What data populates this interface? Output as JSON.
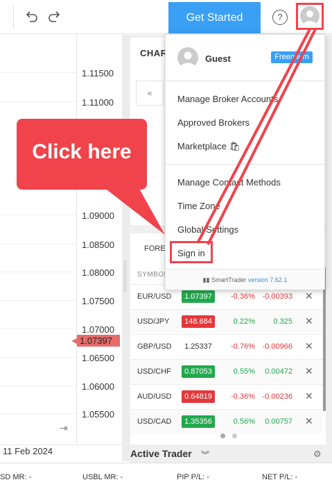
{
  "toolbar": {
    "undo_icon": "undo-icon",
    "redo_icon": "redo-icon",
    "get_started_label": "Get Started",
    "help_label": "?",
    "avatar_icon": "user-avatar-icon"
  },
  "chart": {
    "price_labels": [
      "1.11500",
      "1.11000",
      "1.09000",
      "1.08500",
      "1.08000",
      "1.07500",
      "1.07000",
      "1.06500",
      "1.06000",
      "1.05500"
    ],
    "current_price": "1.07397",
    "date_label": "11 Feb 2024",
    "jump_icon": "jump-to-end-icon",
    "marker_color": "#e86a6a"
  },
  "chart_panel": {
    "title": "CHAR",
    "toggle_label": "«"
  },
  "forex": {
    "tab_label": "FOREX",
    "symbol_header": "SYMBOL",
    "rows": [
      {
        "symbol": "EUR/USD",
        "price": "1.07397",
        "dir": "up",
        "pct": "-0.36%",
        "pct_dir": "neg",
        "change": "-0.00393",
        "change_dir": "neg"
      },
      {
        "symbol": "USD/JPY",
        "price": "148.684",
        "dir": "down",
        "pct": "0.22%",
        "pct_dir": "pos",
        "change": "0.325",
        "change_dir": "pos"
      },
      {
        "symbol": "GBP/USD",
        "price": "1.25337",
        "dir": "flat",
        "pct": "-0.76%",
        "pct_dir": "neg",
        "change": "-0.00966",
        "change_dir": "neg"
      },
      {
        "symbol": "USD/CHF",
        "price": "0.87053",
        "dir": "up",
        "pct": "0.55%",
        "pct_dir": "pos",
        "change": "0.00472",
        "change_dir": "pos"
      },
      {
        "symbol": "AUD/USD",
        "price": "0.64819",
        "dir": "down",
        "pct": "-0.36%",
        "pct_dir": "neg",
        "change": "-0.00236",
        "change_dir": "neg"
      },
      {
        "symbol": "USD/CAD",
        "price": "1.35356",
        "dir": "up",
        "pct": "0.56%",
        "pct_dir": "pos",
        "change": "0.00757",
        "change_dir": "pos"
      }
    ],
    "remove_label": "✕"
  },
  "active_trader": {
    "label": "Active Trader",
    "chevron": "︾",
    "settings_icon": "gear-icon"
  },
  "status_bar": {
    "items": [
      {
        "label": "SD MR:",
        "value": "-"
      },
      {
        "label": "USBL MR:",
        "value": "-"
      },
      {
        "label": "PIP P/L:",
        "value": "-"
      },
      {
        "label": "NET P/L:",
        "value": "-"
      }
    ]
  },
  "user_menu": {
    "user_name": "Guest",
    "badge": "Freemium",
    "items_group1": [
      "Manage Broker Accounts",
      "Approved Brokers",
      "Marketplace"
    ],
    "items_group2": [
      "Manage Contact Methods",
      "Time Zone",
      "Global Settings",
      "Sign in"
    ],
    "footer_app": "SmartTrader",
    "footer_version": "version 7.62.1"
  },
  "callout": {
    "text": "Click here",
    "color": "#f0434b"
  },
  "colors": {
    "accent": "#3aa0f5",
    "up": "#22a94d",
    "down": "#e5373a"
  }
}
